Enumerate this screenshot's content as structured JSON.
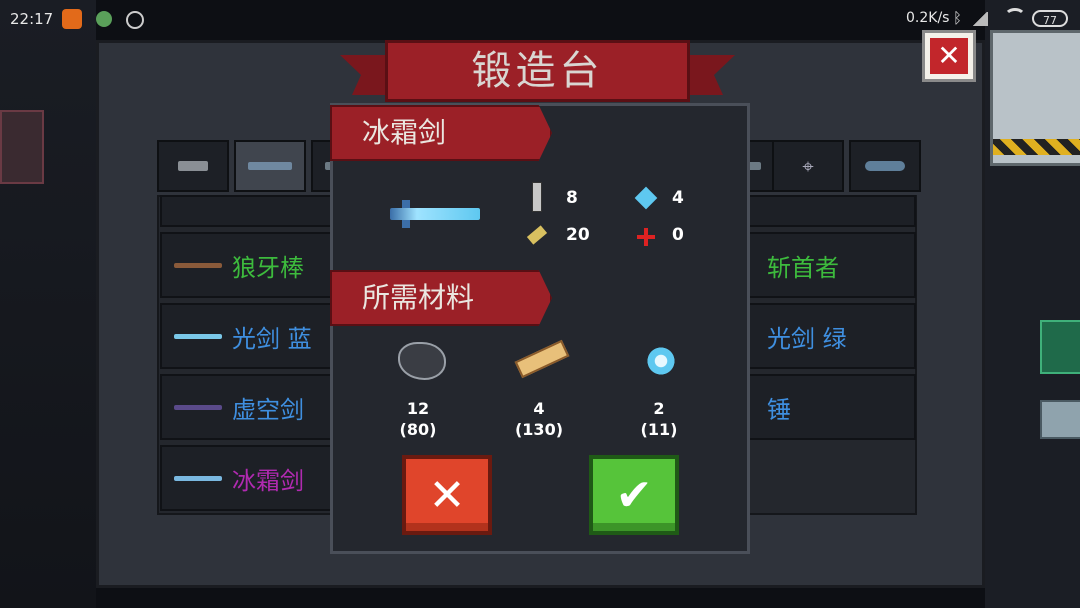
{
  "status_bar": {
    "time": "22:17",
    "net_speed": "0.2K/s",
    "battery": "77",
    "icons": [
      "app-icon",
      "frog-icon",
      "timer-icon",
      "bluetooth-icon",
      "signal-icon",
      "wifi-icon"
    ]
  },
  "forge": {
    "title": "锻造台",
    "close_label": "✕",
    "tabs": [
      "pistol-icon",
      "rifle-icon",
      "blade-icon",
      "blade-icon",
      "crosshair-icon",
      "fish-icon"
    ],
    "weapons_left": [
      {
        "name": "狼牙棒",
        "color": "#3dbb3d"
      },
      {
        "name": "光剑 蓝",
        "color": "#3f8fe0"
      },
      {
        "name": "虚空剑",
        "color": "#3f8fe0"
      },
      {
        "name": "冰霜剑",
        "color": "#b02ab0"
      }
    ],
    "weapons_right": [
      {
        "name": "斩首者",
        "color": "#3dbb3d"
      },
      {
        "name": "光剑 绿",
        "color": "#3f8fe0"
      },
      {
        "name": "锤",
        "color": "#3f8fe0"
      }
    ]
  },
  "dialog": {
    "weapon_name": "冰霜剑",
    "stats": {
      "attack": "8",
      "energy": "4",
      "crit": "20",
      "accuracy": "0"
    },
    "materials_title": "所需材料",
    "materials": [
      {
        "icon": "ore-icon",
        "need": "12",
        "have": "(80)"
      },
      {
        "icon": "wood-icon",
        "need": "4",
        "have": "(130)"
      },
      {
        "icon": "ice-crystal-icon",
        "need": "2",
        "have": "(11)"
      }
    ],
    "cancel_label": "✕",
    "confirm_label": "✔"
  },
  "colors": {
    "banner": "#9b2027",
    "cancel": "#e0452b",
    "confirm": "#56c43a",
    "energy": "#5ec8f0"
  }
}
